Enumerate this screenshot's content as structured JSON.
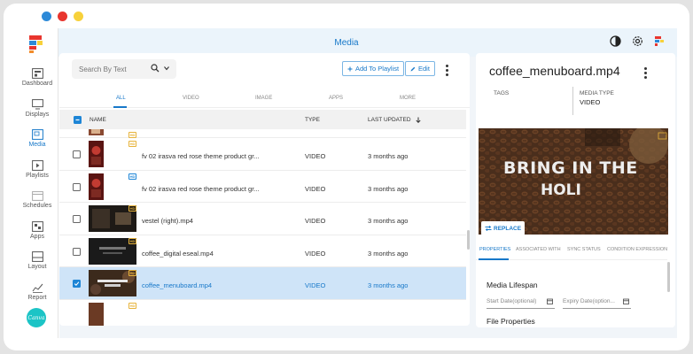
{
  "window": {
    "dots": [
      "#2d8ad8",
      "#e8352e",
      "#f7d13b"
    ]
  },
  "header": {
    "title": "Media"
  },
  "sidebar": {
    "items": [
      {
        "label": "Dashboard",
        "icon": "dashboard-icon",
        "active": false
      },
      {
        "label": "Displays",
        "icon": "display-icon",
        "active": false
      },
      {
        "label": "Media",
        "icon": "media-icon",
        "active": true
      },
      {
        "label": "Playlists",
        "icon": "playlist-icon",
        "active": false
      },
      {
        "label": "Schedules",
        "icon": "schedule-icon",
        "active": false
      },
      {
        "label": "Apps",
        "icon": "apps-icon",
        "active": false
      },
      {
        "label": "Layout",
        "icon": "layout-icon",
        "active": false
      },
      {
        "label": "Report",
        "icon": "report-icon",
        "active": false
      }
    ],
    "canva_label": "Canva"
  },
  "toolbar": {
    "search_placeholder": "Search By Text",
    "add_to_playlist": "Add To Playlist",
    "edit": "Edit"
  },
  "tabs": [
    "ALL",
    "VIDEO",
    "IMAGE",
    "APPS",
    "MORE"
  ],
  "table": {
    "headers": {
      "name": "NAME",
      "type": "TYPE",
      "updated": "LAST UPDATED"
    },
    "rows": [
      {
        "name": "",
        "type": "",
        "updated": "",
        "badge": "HD",
        "partial": true
      },
      {
        "name": "fv 02 irasva red rose theme product gr...",
        "type": "VIDEO",
        "updated": "3 months ago",
        "badge": "HD"
      },
      {
        "name": "fv 02 irasva red rose theme product gr...",
        "type": "VIDEO",
        "updated": "3 months ago",
        "badge": "HD"
      },
      {
        "name": "vestel (right).mp4",
        "type": "VIDEO",
        "updated": "3 months ago",
        "badge": "HD"
      },
      {
        "name": "coffee_digital eseal.mp4",
        "type": "VIDEO",
        "updated": "3 months ago",
        "badge": "HD"
      },
      {
        "name": "coffee_menuboard.mp4",
        "type": "VIDEO",
        "updated": "3 months ago",
        "badge": "HD",
        "selected": true
      }
    ]
  },
  "details": {
    "title": "coffee_menuboard.mp4",
    "tags_label": "TAGS",
    "media_type_label": "MEDIA TYPE",
    "media_type_value": "VIDEO",
    "preview_text_line1": "BRING IN THE",
    "preview_text_line2": "HOLI",
    "replace_label": "REPLACE",
    "tabs": [
      "PROPERTIES",
      "ASSOCIATED WITH",
      "SYNC STATUS",
      "CONDITION EXPRESSION"
    ],
    "lifespan_title": "Media Lifespan",
    "start_date_placeholder": "Start Date(optional)",
    "expiry_date_placeholder": "Expiry Date(option...",
    "file_properties_title": "File Properties"
  },
  "colors": {
    "accent": "#1778c9",
    "selected_row": "#cfe4f8",
    "hd_badge": "#e7b33a"
  }
}
